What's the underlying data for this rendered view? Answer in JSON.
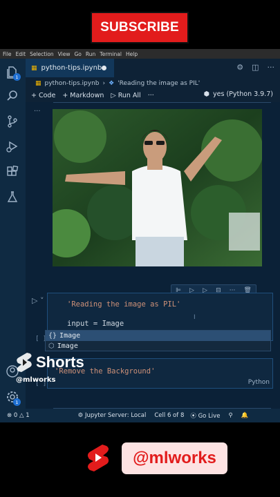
{
  "overlay": {
    "subscribe_label": "SUBSCRIBE",
    "shorts_label": "Shorts",
    "shorts_handle": "@mlworks",
    "brand_handle": "@mlworks"
  },
  "menubar": [
    "File",
    "Edit",
    "Selection",
    "View",
    "Go",
    "Run",
    "Terminal",
    "Help"
  ],
  "activity": {
    "explorer_badge": "1",
    "accounts_badge": "1"
  },
  "tab": {
    "filename": "python-tips.ipynb"
  },
  "breadcrumb": {
    "file": "python-tips.ipynb",
    "section": "'Reading the image as PIL'"
  },
  "toolbar": {
    "code_label": "Code",
    "markdown_label": "Markdown",
    "run_all_label": "Run All",
    "more_label": "···",
    "kernel_label": "yes (Python 3.9.7)"
  },
  "cells": {
    "ellipsis": "···",
    "code_comment": "'Reading the image as PIL'",
    "input_line_var": "input",
    "input_line_op": " = ",
    "input_line_val": "Image",
    "bracket_1": "[ ]",
    "bracket_2": "[ ]",
    "suggest_1": "Image",
    "suggest_2": "Image",
    "md_text": "'Remove the Background'",
    "md_lang": "Python"
  },
  "statusbar": {
    "errors": "0",
    "warnings": "1",
    "jupyter": "Jupyter Server: Local",
    "cell_pos": "Cell 6 of 8",
    "go_live": "Go Live"
  }
}
